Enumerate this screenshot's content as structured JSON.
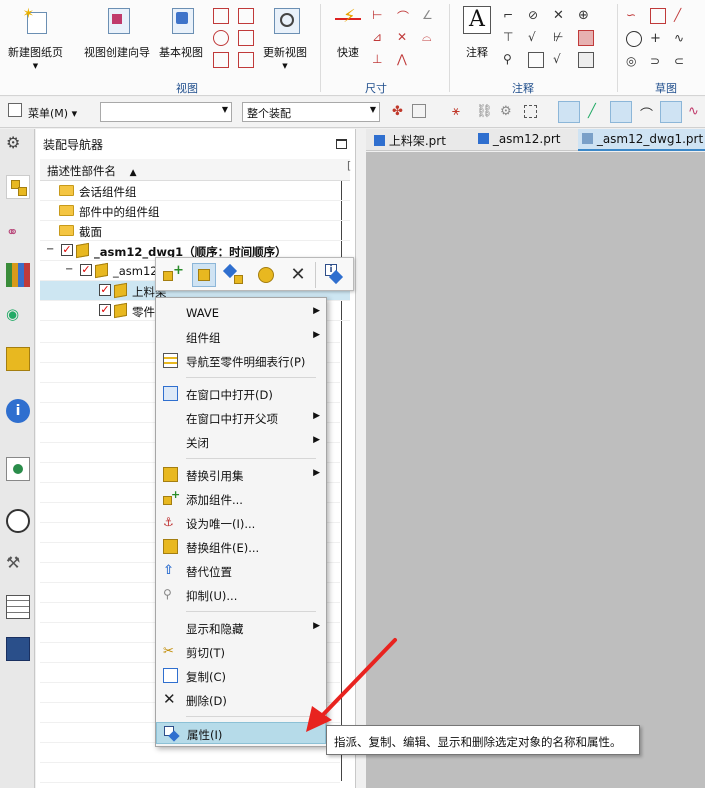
{
  "ribbon": {
    "buttons": [
      {
        "label": "新建图纸页",
        "icon": "new-sheet-icon",
        "has_dropdown": true
      },
      {
        "label": "视图创建向导",
        "icon": "view-wizard-icon",
        "has_dropdown": false
      },
      {
        "label": "基本视图",
        "icon": "base-view-icon",
        "has_dropdown": false
      },
      {
        "label": "更新视图",
        "icon": "update-view-icon",
        "has_dropdown": true
      },
      {
        "label": "快速",
        "icon": "rapid-dimension-icon",
        "has_dropdown": false
      },
      {
        "label": "注释",
        "icon": "note-icon",
        "has_dropdown": false
      }
    ],
    "groups": [
      "视图",
      "尺寸",
      "注释",
      "草图"
    ]
  },
  "toolbar": {
    "menu_label": "菜单(M)",
    "filter_value": "",
    "scope_value": "整个装配"
  },
  "navigator": {
    "title": "装配导航器",
    "column_header": "描述性部件名",
    "rows": [
      {
        "label": "会话组件组",
        "type": "folder"
      },
      {
        "label": "部件中的组件组",
        "type": "folder"
      },
      {
        "label": "截面",
        "type": "folder"
      },
      {
        "label": "_asm12_dwg1（顺序：时间顺序）",
        "type": "assembly"
      },
      {
        "label": "_asm12",
        "type": "subassembly"
      },
      {
        "label": "上料架",
        "type": "component"
      },
      {
        "label": "零件",
        "type": "component"
      }
    ]
  },
  "tabs": [
    {
      "label": "上料架.prt",
      "active": false
    },
    {
      "label": "_asm12.prt",
      "active": false
    },
    {
      "label": "_asm12_dwg1.prt",
      "active": true
    }
  ],
  "context_menu": {
    "items": [
      {
        "label": "WAVE",
        "submenu": true
      },
      {
        "label": "组件组",
        "submenu": true
      },
      {
        "label": "导航至零件明细表行(P)",
        "submenu": false
      },
      {
        "label": "在窗口中打开(D)",
        "submenu": false
      },
      {
        "label": "在窗口中打开父项",
        "submenu": true
      },
      {
        "label": "关闭",
        "submenu": true
      },
      {
        "label": "替换引用集",
        "submenu": true
      },
      {
        "label": "添加组件...",
        "submenu": false
      },
      {
        "label": "设为唯一(I)...",
        "submenu": false
      },
      {
        "label": "替换组件(E)...",
        "submenu": false
      },
      {
        "label": "替代位置",
        "submenu": false
      },
      {
        "label": "抑制(U)...",
        "submenu": false
      },
      {
        "label": "显示和隐藏",
        "submenu": true
      },
      {
        "label": "剪切(T)",
        "submenu": false
      },
      {
        "label": "复制(C)",
        "submenu": false
      },
      {
        "label": "删除(D)",
        "submenu": false
      },
      {
        "label": "属性(I)",
        "submenu": false,
        "highlighted": true
      }
    ]
  },
  "tooltip": "指派、复制、编辑、显示和删除选定对象的名称和属性。",
  "colors": {
    "highlight": "#b6dbe9",
    "arrow": "#e8231f",
    "group_label": "#1f4e8c"
  }
}
